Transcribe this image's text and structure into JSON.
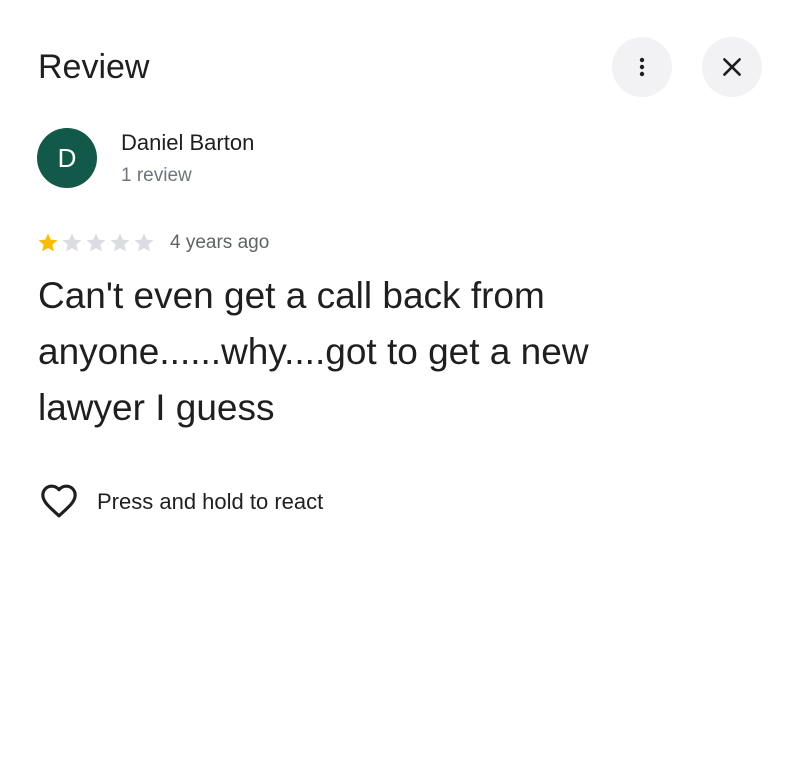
{
  "header": {
    "title": "Review",
    "more_icon": "more-vert-icon",
    "close_icon": "close-icon"
  },
  "author": {
    "initial": "D",
    "name": "Daniel Barton",
    "meta": "1 review",
    "avatar_color": "#12594a"
  },
  "rating": {
    "stars": 1,
    "max_stars": 5,
    "filled_color": "#fbbc04",
    "empty_color": "#dadce0",
    "date": "4 years ago"
  },
  "review": {
    "text": "Can't even get a call back from anyone......why....got to get a new lawyer I guess"
  },
  "react": {
    "label": "Press and hold to react",
    "icon": "heart-outline-icon"
  }
}
